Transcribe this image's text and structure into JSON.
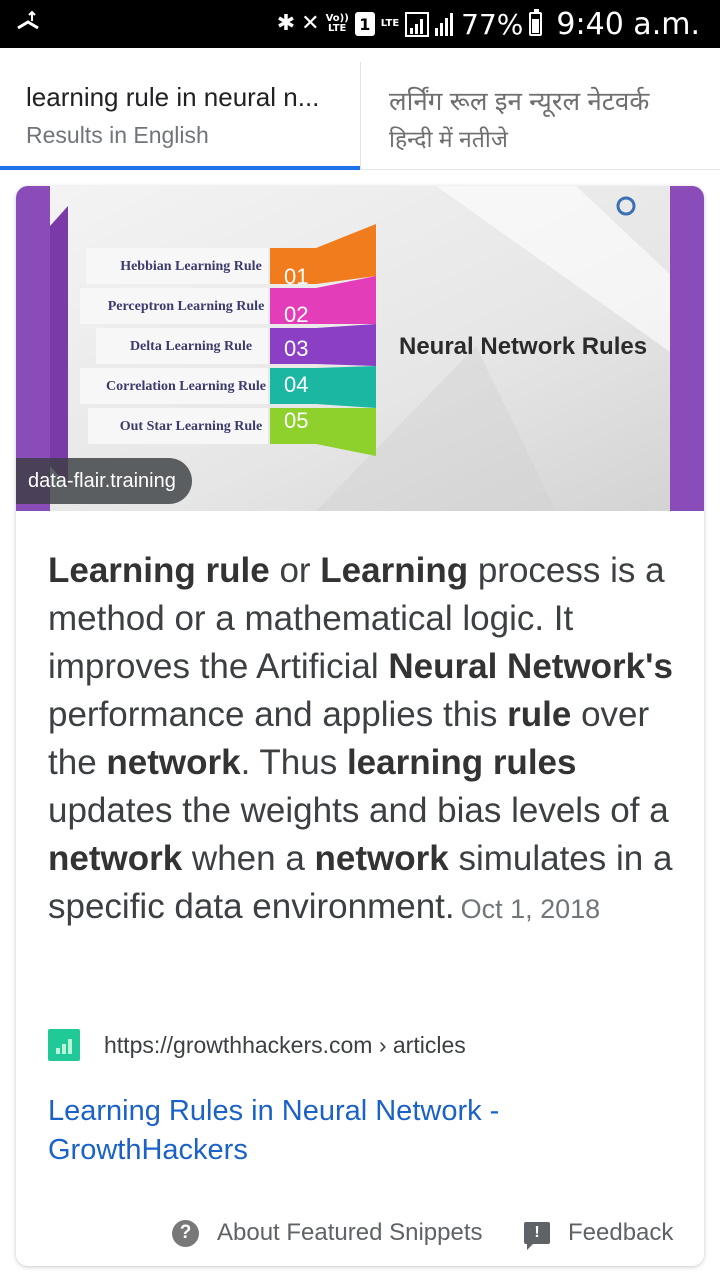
{
  "status_bar": {
    "lte_label": "LTE",
    "volte_label": "Vo))\nLTE",
    "sim_number": "1",
    "battery_percent": "77%",
    "time": "9:40 a.m.",
    "icons": [
      "usb-notification-icon",
      "bluetooth-icon",
      "mute-icon",
      "signal-icon",
      "battery-icon"
    ]
  },
  "tabs": [
    {
      "title": "learning rule in neural n...",
      "subtitle": "Results in English",
      "selected": true
    },
    {
      "title": "लर्निंग रूल इन न्यूरल नेटवर्क",
      "subtitle": "हिन्दी में नतीजे",
      "selected": false
    }
  ],
  "featured": {
    "image": {
      "source": "data-flair.training",
      "rules": [
        {
          "label": "Hebbian Learning Rule",
          "num": "01"
        },
        {
          "label": "Perceptron Learning Rule",
          "num": "02"
        },
        {
          "label": "Delta Learning Rule",
          "num": "03"
        },
        {
          "label": "Correlation Learning Rule",
          "num": "04"
        },
        {
          "label": "Out Star Learning Rule",
          "num": "05"
        }
      ],
      "title": "Neural Network Rules",
      "logo_text": "Data Flair",
      "colors": [
        "#f07c1e",
        "#e43dba",
        "#8a3fc4",
        "#1cb7a2",
        "#8ed02c"
      ]
    },
    "snippet": {
      "p1_b1": "Learning rule",
      "p1_t1": " or ",
      "p1_b2": "Learning",
      "p1_t2": " process is a method or a mathematical logic. It improves the Artificial ",
      "p1_b3": "Neural Network's",
      "p1_t3": " performance and applies this ",
      "p1_b4": "rule",
      "p1_t4": " over the ",
      "p1_b5": "network",
      "p1_t5": ". Thus ",
      "p1_b6": "learning rules",
      "p1_t6": " updates the weights and bias levels of a ",
      "p1_b7": "network",
      "p1_t7": " when a ",
      "p1_b8": "network",
      "p1_t8": " simulates in a specific data environment.",
      "date": "Oct 1, 2018"
    },
    "source_url": "https://growthhackers.com › articles",
    "link_title": "Learning Rules in Neural Network - GrowthHackers",
    "about_label": "About Featured Snippets",
    "feedback_label": "Feedback"
  }
}
